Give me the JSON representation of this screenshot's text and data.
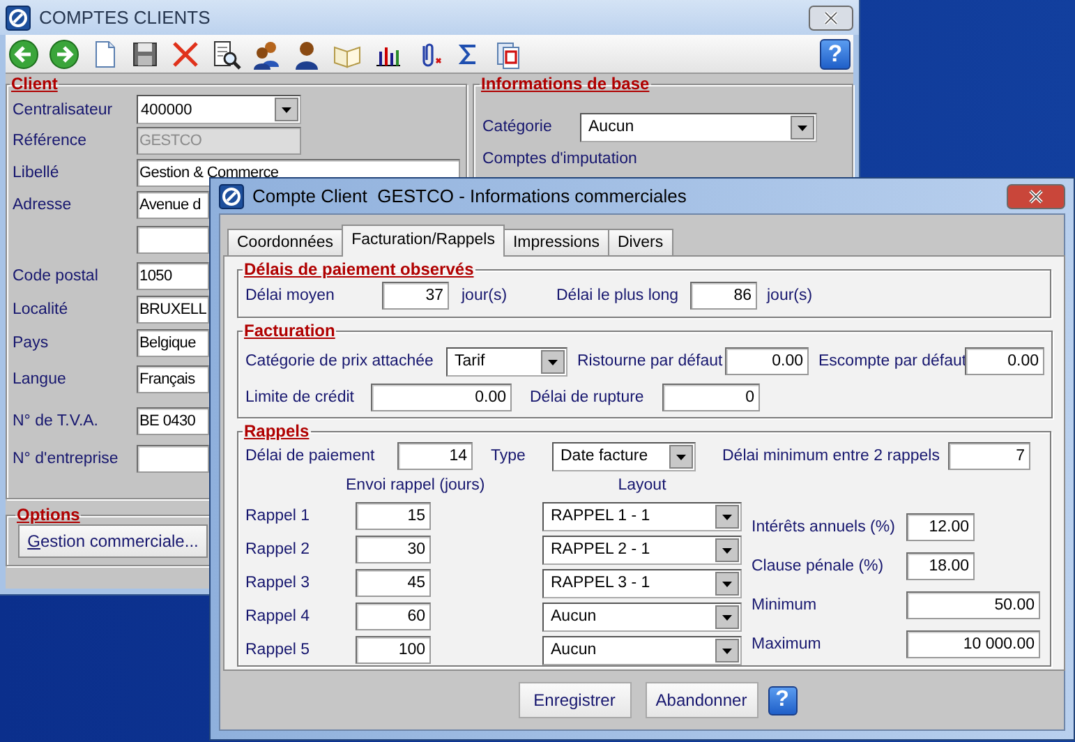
{
  "client_window": {
    "title": "COMPTES CLIENTS",
    "help": "?",
    "client_group": {
      "title": "Client",
      "fields": [
        {
          "label": "Centralisateur",
          "value": "400000",
          "kind": "combo",
          "disabled": false
        },
        {
          "label": "Référence",
          "value": "GESTCO",
          "kind": "text",
          "disabled": true
        },
        {
          "label": "Libellé",
          "value": "Gestion & Commerce",
          "kind": "text",
          "disabled": false
        },
        {
          "label": "Adresse",
          "value": "Avenue d",
          "kind": "text",
          "disabled": false
        },
        {
          "kind": "text",
          "disabled": false
        },
        {
          "label": "Code postal",
          "value": "1050",
          "kind": "text",
          "disabled": false
        },
        {
          "label": "Localité",
          "value": "BRUXELL",
          "kind": "text",
          "disabled": false
        },
        {
          "label": "Pays",
          "value": "Belgique",
          "kind": "text",
          "disabled": false
        },
        {
          "label": "Langue",
          "value": "Français",
          "kind": "text",
          "disabled": false
        },
        {
          "label": "N° de T.V.A.",
          "value": "BE 0430",
          "kind": "text",
          "disabled": false
        },
        {
          "label": "N° d'entreprise",
          "kind": "text",
          "disabled": false
        }
      ]
    },
    "base_group": {
      "title": "Informations de base",
      "category_label": "Catégorie",
      "category_value": "Aucun",
      "accounts_label": "Comptes d'imputation"
    },
    "options_group": {
      "title": "Options",
      "button": "Gestion commerciale..."
    }
  },
  "dialog": {
    "title": "Compte Client  GESTCO - Informations commerciales",
    "tabs": [
      {
        "label": "Coordonnées",
        "selected": false
      },
      {
        "label": "Facturation/Rappels",
        "selected": true
      },
      {
        "label": "Impressions",
        "selected": false
      },
      {
        "label": "Divers",
        "selected": false
      }
    ],
    "delays": {
      "title": "Délais de paiement observés",
      "average_label": "Délai moyen",
      "average_value": "37",
      "average_unit": "jour(s)",
      "longest_label": "Délai le plus long",
      "longest_value": "86",
      "longest_unit": "jour(s)"
    },
    "billing": {
      "title": "Facturation",
      "price_category_label": "Catégorie de prix attachée",
      "price_category_value": "Tarif",
      "rebate_label": "Ristourne par défaut",
      "rebate_value": "0.00",
      "discount_label": "Escompte par défaut",
      "discount_value": "0.00",
      "credit_label": "Limite de crédit",
      "credit_value": "0.00",
      "break_label": "Délai de rupture",
      "break_value": "0"
    },
    "reminders": {
      "title": "Rappels",
      "payment_label": "Délai de paiement",
      "payment_value": "14",
      "type_label": "Type",
      "type_value": "Date facture",
      "min_label": "Délai minimum entre 2 rappels",
      "min_value": "7",
      "days_header": "Envoi rappel (jours)",
      "layout_header": "Layout",
      "rows": [
        {
          "label": "Rappel 1",
          "days": "15",
          "layout": "RAPPEL 1 - 1"
        },
        {
          "label": "Rappel 2",
          "days": "30",
          "layout": "RAPPEL 2 - 1"
        },
        {
          "label": "Rappel 3",
          "days": "45",
          "layout": "RAPPEL 3 - 1"
        },
        {
          "label": "Rappel 4",
          "days": "60",
          "layout": "Aucun"
        },
        {
          "label": "Rappel 5",
          "days": "100",
          "layout": "Aucun"
        }
      ],
      "extras": [
        {
          "label": "Intérêts annuels (%)",
          "value": "12.00",
          "wide": false
        },
        {
          "label": "Clause pénale (%)",
          "value": "18.00",
          "wide": false
        },
        {
          "label": "Minimum",
          "value": "50.00",
          "wide": true
        },
        {
          "label": "Maximum",
          "value": "10 000.00",
          "wide": true
        }
      ]
    },
    "buttons": [
      "Enregistrer",
      "Abandonner"
    ],
    "help": "?"
  }
}
